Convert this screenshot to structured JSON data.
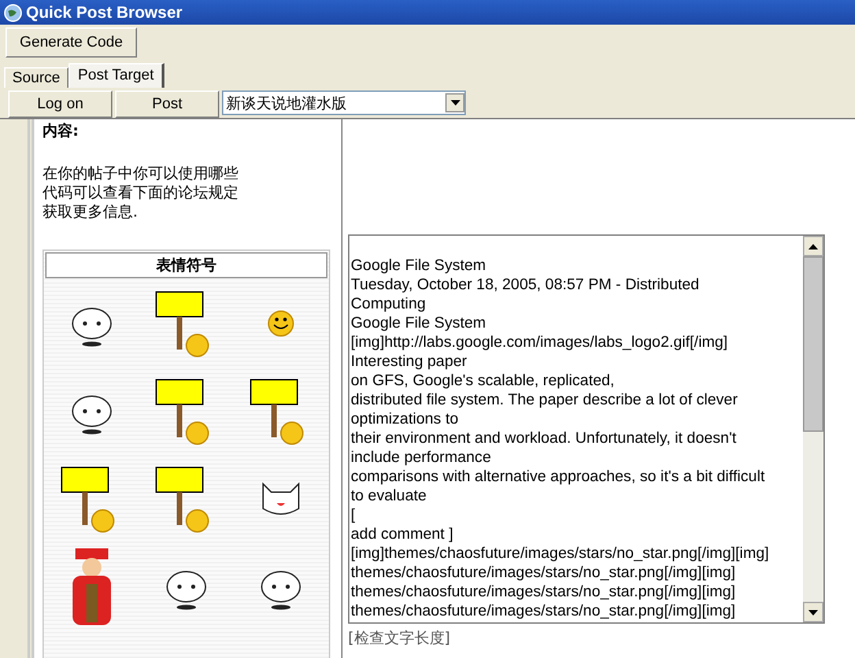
{
  "window": {
    "title": "Quick Post Browser"
  },
  "toolbar": {
    "buttons": [
      "Generate Code"
    ]
  },
  "tabs": [
    {
      "label": "Source",
      "selected": false
    },
    {
      "label": "Post Target",
      "selected": true
    }
  ],
  "actions": {
    "buttons": [
      "Log on",
      "Post"
    ],
    "forum_select": {
      "value": "新谈天说地灌水版"
    }
  },
  "page": {
    "content_label": "内容:",
    "help_text": [
      "在你的帖子中你可以使用哪些",
      "代码可以查看下面的论坛规定",
      "获取更多信息."
    ],
    "emoticon_panel": {
      "title": "表情符号"
    }
  },
  "editor": {
    "text": "\nGoogle File System\nTuesday, October 18, 2005, 08:57 PM - Distributed\nComputing\nGoogle File System\n[img]http://labs.google.com/images/labs_logo2.gif[/img]\nInteresting paper\non GFS, Google's scalable, replicated,\ndistributed file system. The paper describe a lot of clever\noptimizations to\ntheir environment and workload. Unfortunately, it doesn't\ninclude performance\ncomparisons with alternative approaches, so it's a bit difficult\nto evaluate\n[\nadd comment ]\n[img]themes/chaosfuture/images/stars/no_star.png[/img][img]\nthemes/chaosfuture/images/stars/no_star.png[/img][img]\nthemes/chaosfuture/images/stars/no_star.png[/img][img]\nthemes/chaosfuture/images/stars/no_star.png[/img][img]"
  },
  "check_length_link": "[检查文字长度]"
}
